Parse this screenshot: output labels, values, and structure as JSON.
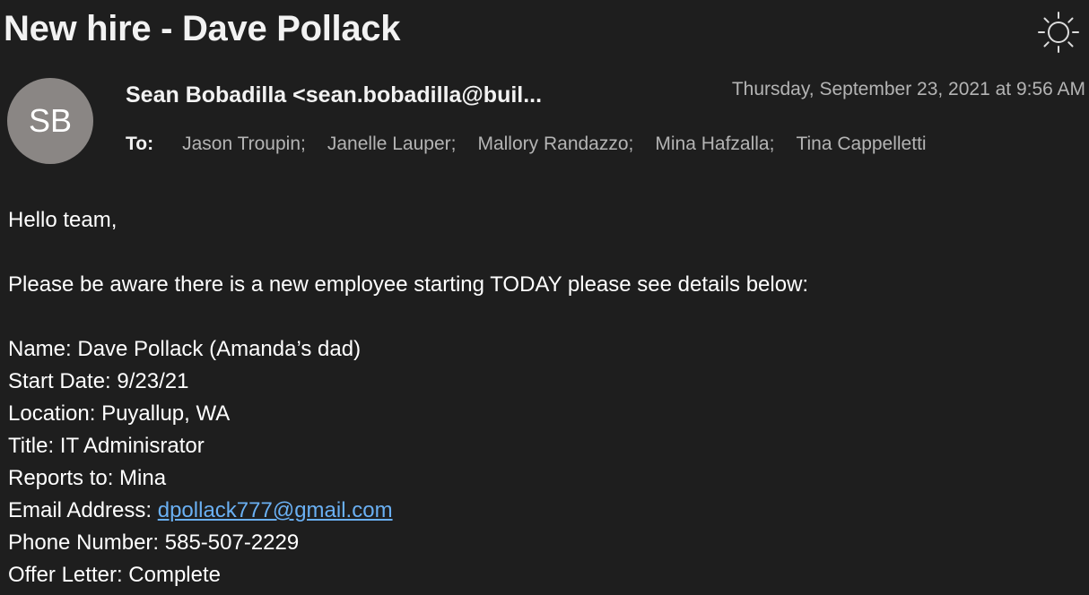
{
  "subject": "New hire - Dave Pollack",
  "theme_toggle_icon": "sun-icon",
  "sender": {
    "initials": "SB",
    "display": "Sean Bobadilla <sean.bobadilla@buil..."
  },
  "date": "Thursday, September 23, 2021 at 9:56 AM",
  "to": {
    "label": "To:",
    "recipients": [
      "Jason Troupin;",
      "Janelle Lauper;",
      "Mallory Randazzo;",
      "Mina Hafzalla;",
      "Tina Cappelletti"
    ]
  },
  "body": {
    "greeting": "Hello team,",
    "intro": "Please be aware there is a new employee starting TODAY please see details below:",
    "name": "Name: Dave Pollack (Amanda’s dad)",
    "start_date": "Start Date: 9/23/21",
    "location": "Location: Puyallup, WA",
    "title": "Title: IT Adminisrator",
    "reports_to": "Reports to: Mina",
    "email_label": "Email Address: ",
    "email_value": "dpollack777@gmail.com",
    "phone": "Phone Number: 585-507-2229",
    "offer": "Offer Letter: Complete"
  },
  "colors": {
    "background": "#1e1e1e",
    "link": "#6ab0f3",
    "avatar": "#8a8684"
  }
}
